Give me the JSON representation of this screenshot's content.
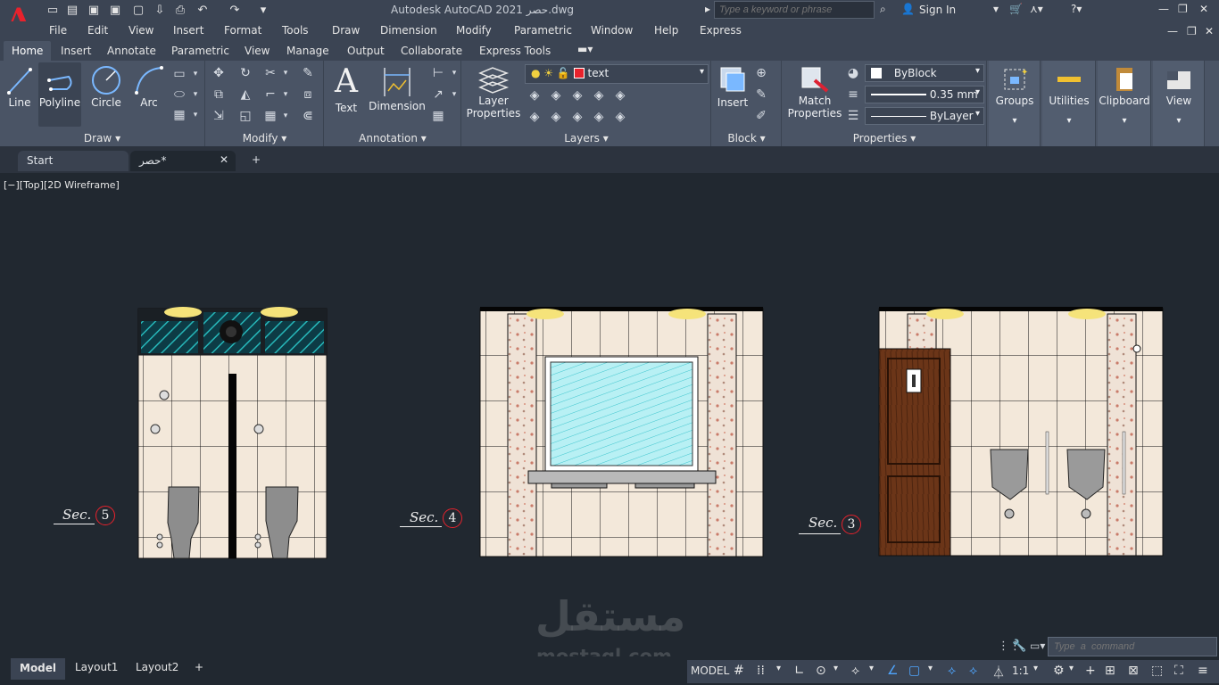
{
  "app": {
    "title": "Autodesk AutoCAD 2021   حصر.dwg",
    "logo": "A"
  },
  "search": {
    "placeholder": "Type a keyword or phrase"
  },
  "signin": {
    "label": "Sign In"
  },
  "menu": [
    "File",
    "Edit",
    "View",
    "Insert",
    "Format",
    "Tools",
    "Draw",
    "Dimension",
    "Modify",
    "Parametric",
    "Window",
    "Help",
    "Express"
  ],
  "ribbon_tabs": [
    "Home",
    "Insert",
    "Annotate",
    "Parametric",
    "View",
    "Manage",
    "Output",
    "Collaborate",
    "Express Tools"
  ],
  "panels": {
    "draw": {
      "title": "Draw",
      "line": "Line",
      "polyline": "Polyline",
      "circle": "Circle",
      "arc": "Arc"
    },
    "modify": {
      "title": "Modify"
    },
    "annotation": {
      "title": "Annotation",
      "text": "Text",
      "dimension": "Dimension"
    },
    "layers": {
      "title": "Layers",
      "layer_properties_1": "Layer",
      "layer_properties_2": "Properties",
      "current_layer": "text",
      "current_layer_color": "#e8222c"
    },
    "block": {
      "title": "Block",
      "insert": "Insert"
    },
    "properties": {
      "title": "Properties",
      "match_1": "Match",
      "match_2": "Properties",
      "color": "ByBlock",
      "lineweight": "0.35 mm",
      "linetype": "ByLayer"
    },
    "groups": {
      "label": "Groups"
    },
    "utilities": {
      "label": "Utilities"
    },
    "clipboard": {
      "label": "Clipboard"
    },
    "view": {
      "label": "View"
    }
  },
  "doc_tabs": {
    "start": "Start",
    "drawing": "حصر*",
    "close": "✕",
    "add": "+"
  },
  "viewport_label": "[−][Top][2D Wireframe]",
  "sections": [
    {
      "label": "Sec.",
      "number": "5"
    },
    {
      "label": "Sec.",
      "number": "4"
    },
    {
      "label": "Sec.",
      "number": "3"
    }
  ],
  "watermark": {
    "arabic": "مستقل",
    "latin": "mostaql.com"
  },
  "command": {
    "placeholder": "Type  a  command"
  },
  "layout_tabs": [
    "Model",
    "Layout1",
    "Layout2"
  ],
  "status": {
    "model": "MODEL",
    "scale": "1:1"
  }
}
